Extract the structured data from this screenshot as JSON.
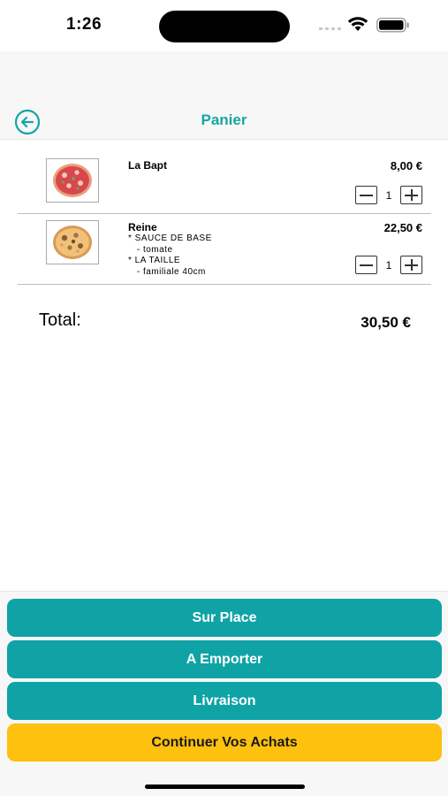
{
  "status_bar": {
    "time": "1:26"
  },
  "nav": {
    "title": "Panier",
    "back_icon": "arrow-left-circle-icon"
  },
  "cart": {
    "items": [
      {
        "name": "La Bapt",
        "price": "8,00 €",
        "quantity": "1",
        "options": [],
        "thumb_icon": "pizza-icon"
      },
      {
        "name": "Reine",
        "price": "22,50 €",
        "quantity": "1",
        "options": [
          "* SAUCE DE BASE",
          "   - tomate",
          "* LA TAILLE",
          "   - familiale 40cm"
        ],
        "thumb_icon": "pizza-icon"
      }
    ],
    "total_label": "Total:",
    "total_value": "30,50 €"
  },
  "actions": {
    "sur_place": "Sur Place",
    "a_emporter": "A Emporter",
    "livraison": "Livraison",
    "continuer": "Continuer Vos Achats"
  },
  "colors": {
    "accent": "#0fa3a6",
    "title": "#16a5a5",
    "continue": "#fdc10e"
  }
}
